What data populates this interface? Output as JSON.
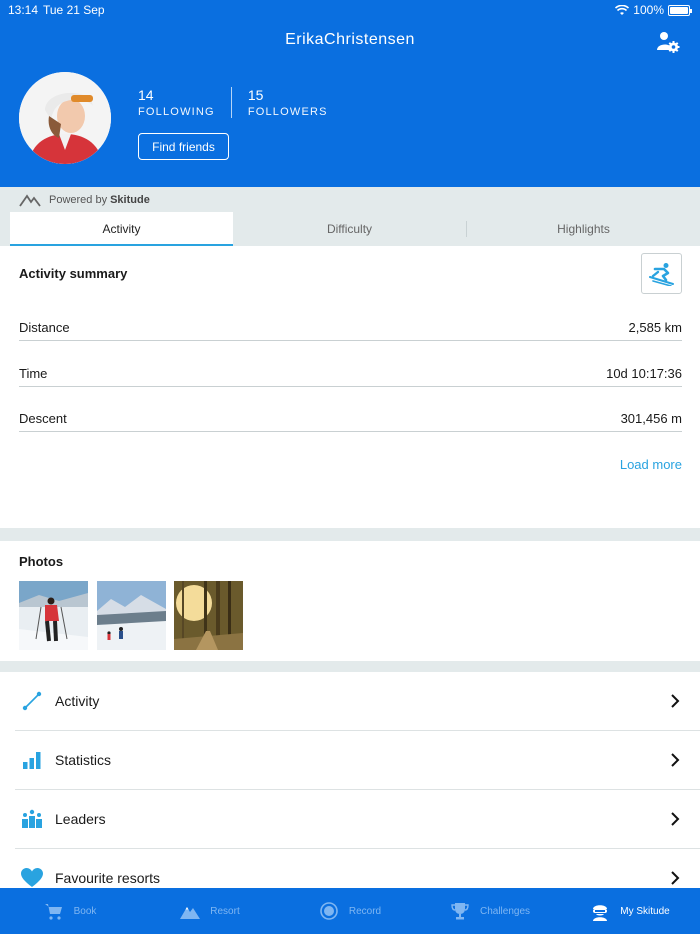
{
  "status": {
    "time": "13:14",
    "date": "Tue 21 Sep",
    "battery": "100%"
  },
  "profile": {
    "username": "ErikaChristensen",
    "following_count": "14",
    "following_label": "FOLLOWING",
    "followers_count": "15",
    "followers_label": "FOLLOWERS",
    "find_friends": "Find friends"
  },
  "powered": {
    "prefix": "Powered by",
    "brand": "Skitude"
  },
  "tabs": [
    {
      "label": "Activity",
      "active": true
    },
    {
      "label": "Difficulty",
      "active": false
    },
    {
      "label": "Highlights",
      "active": false
    }
  ],
  "summary": {
    "title": "Activity summary",
    "rows": [
      {
        "label": "Distance",
        "value": "2,585 km"
      },
      {
        "label": "Time",
        "value": "10d 10:17:36"
      },
      {
        "label": "Descent",
        "value": "301,456 m"
      }
    ],
    "load_more": "Load more"
  },
  "photos": {
    "title": "Photos"
  },
  "menu": [
    {
      "label": "Activity",
      "icon": "activity-icon"
    },
    {
      "label": "Statistics",
      "icon": "statistics-icon"
    },
    {
      "label": "Leaders",
      "icon": "leaders-icon"
    },
    {
      "label": "Favourite resorts",
      "icon": "heart-icon"
    }
  ],
  "nav": [
    {
      "label": "Book",
      "icon": "cart-icon",
      "active": false
    },
    {
      "label": "Resort",
      "icon": "mountain-icon",
      "active": false
    },
    {
      "label": "Record",
      "icon": "record-icon",
      "active": false
    },
    {
      "label": "Challenges",
      "icon": "trophy-icon",
      "active": false
    },
    {
      "label": "My Skitude",
      "icon": "skier-icon",
      "active": true
    }
  ],
  "colors": {
    "brand_blue": "#0a6fe0",
    "accent": "#29a3e0",
    "background": "#e3eaeb"
  }
}
